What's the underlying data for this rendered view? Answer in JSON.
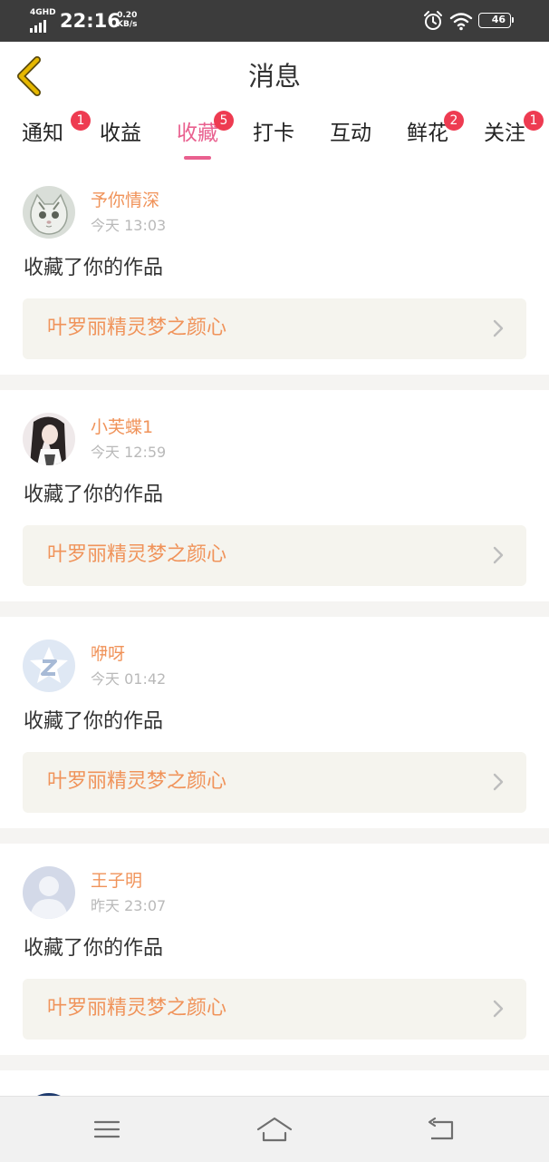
{
  "status_bar": {
    "network": "4GHD",
    "time": "22:16",
    "speed_value": "0.20",
    "speed_unit": "KB/s",
    "battery": "46"
  },
  "header": {
    "title": "消息",
    "back_icon": "chevron-left-icon"
  },
  "tabs": [
    {
      "label": "通知",
      "badge": "1"
    },
    {
      "label": "收益",
      "badge": ""
    },
    {
      "label": "收藏",
      "badge": "5"
    },
    {
      "label": "打卡",
      "badge": ""
    },
    {
      "label": "互动",
      "badge": ""
    },
    {
      "label": "鲜花",
      "badge": "2"
    },
    {
      "label": "关注",
      "badge": "1"
    }
  ],
  "active_tab": "收藏",
  "messages": [
    {
      "user": "予你情深",
      "time": "今天 13:03",
      "action": "收藏了你的作品",
      "work": "叶罗丽精灵梦之颜心"
    },
    {
      "user": "小芙蝶1",
      "time": "今天 12:59",
      "action": "收藏了你的作品",
      "work": "叶罗丽精灵梦之颜心"
    },
    {
      "user": "咿呀",
      "time": "今天 01:42",
      "action": "收藏了你的作品",
      "work": "叶罗丽精灵梦之颜心"
    },
    {
      "user": "王子明",
      "time": "昨天 23:07",
      "action": "收藏了你的作品",
      "work": "叶罗丽精灵梦之颜心"
    }
  ],
  "colors": {
    "accent_pink": "#e9608f",
    "badge_red": "#ee3b51",
    "name_orange": "#f0935a",
    "back_arrow_yellow": "#e6b800"
  },
  "bottom_nav": [
    "menu-icon",
    "home-icon",
    "back-icon"
  ]
}
